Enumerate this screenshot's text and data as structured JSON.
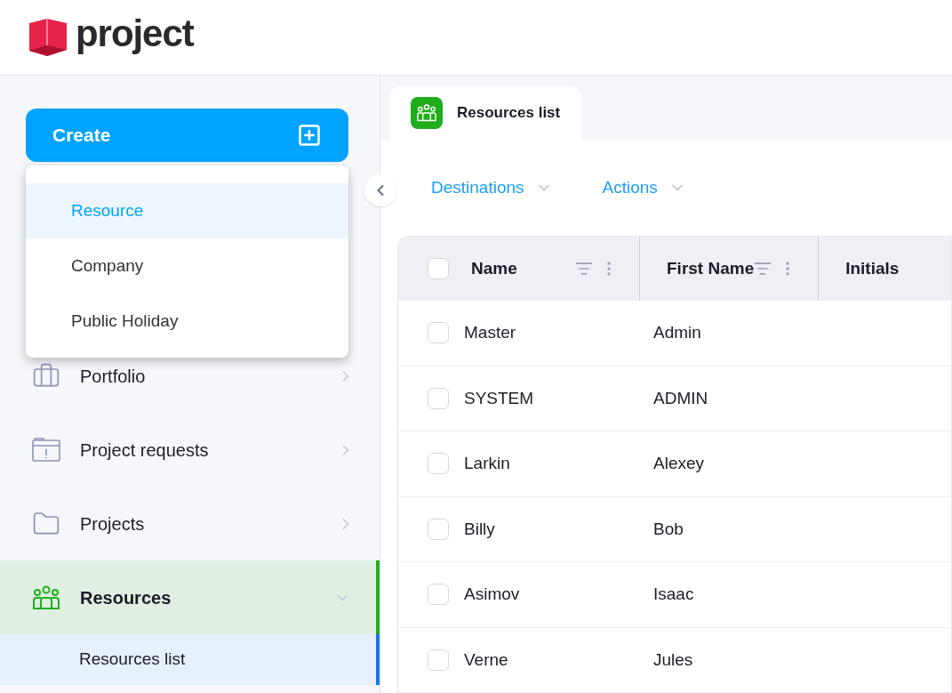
{
  "logo": {
    "text": "project"
  },
  "create_button": {
    "label": "Create"
  },
  "create_menu": {
    "items": [
      {
        "label": "Resource",
        "selected": true
      },
      {
        "label": "Company",
        "selected": false
      },
      {
        "label": "Public Holiday",
        "selected": false
      }
    ]
  },
  "sidebar": {
    "items": [
      {
        "label": "Portfolio",
        "kind": "briefcase",
        "selected": false,
        "expanded": false
      },
      {
        "label": "Project requests",
        "kind": "request",
        "selected": false,
        "expanded": false
      },
      {
        "label": "Projects",
        "kind": "folder",
        "selected": false,
        "expanded": false
      },
      {
        "label": "Resources",
        "kind": "people",
        "selected": true,
        "expanded": true,
        "children": [
          {
            "label": "Resources list",
            "selected": true
          }
        ]
      }
    ]
  },
  "tabs": [
    {
      "label": "Resources list",
      "selected": true
    }
  ],
  "toolbar": [
    "Destinations",
    "Actions"
  ],
  "table": {
    "all_checked": false,
    "columns": [
      "Name",
      "First Name",
      "Initials"
    ],
    "rows": [
      {
        "checked": false,
        "cells": [
          "Master",
          "Admin"
        ]
      },
      {
        "checked": false,
        "cells": [
          "SYSTEM",
          "ADMIN"
        ]
      },
      {
        "checked": false,
        "cells": [
          "Larkin",
          "Alexey"
        ]
      },
      {
        "checked": false,
        "cells": [
          "Billy",
          "Bob"
        ]
      },
      {
        "checked": false,
        "cells": [
          "Asimov",
          "Isaac"
        ]
      },
      {
        "checked": false,
        "cells": [
          "Verne",
          "Jules"
        ]
      }
    ]
  }
}
